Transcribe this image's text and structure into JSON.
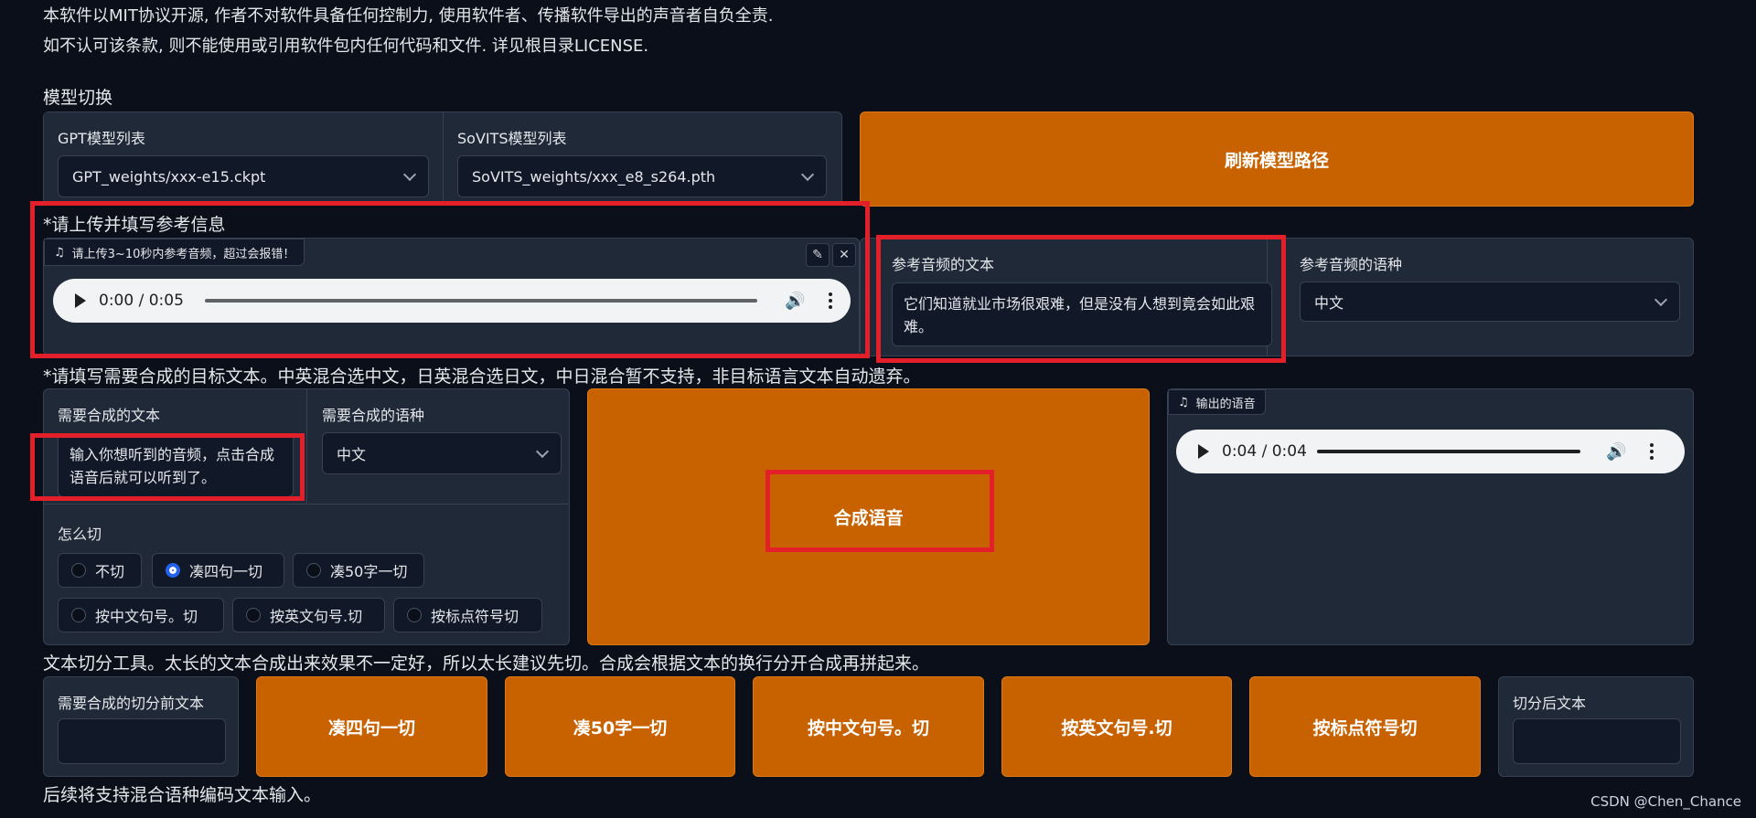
{
  "intro": {
    "line1": "本软件以MIT协议开源, 作者不对软件具备任何控制力, 使用软件者、传播软件导出的声音者自负全责.",
    "line2": "如不认可该条款, 则不能使用或引用软件包内任何代码和文件. 详见根目录LICENSE."
  },
  "model_switch": {
    "section_label": "模型切换",
    "gpt_label": "GPT模型列表",
    "gpt_value": "GPT_weights/xxx-e15.ckpt",
    "sovits_label": "SoVITS模型列表",
    "sovits_value": "SoVITS_weights/xxx_e8_s264.pth",
    "refresh_button": "刷新模型路径"
  },
  "reference": {
    "section_label": "*请上传并填写参考信息",
    "audio_badge": "请上传3~10秒内参考音频，超过会报错！",
    "audio_time": "0:00 / 0:05",
    "audio_progress": 0.0,
    "ref_text_label": "参考音频的文本",
    "ref_text_value": "它们知道就业市场很艰难，但是没有人想到竟会如此艰难。",
    "ref_lang_label": "参考音频的语种",
    "ref_lang_value": "中文"
  },
  "target": {
    "section_label": "*请填写需要合成的目标文本。中英混合选中文，日英混合选日文，中日混合暂不支持，非目标语言文本自动遗弃。",
    "text_label": "需要合成的文本",
    "text_value": "输入你想听到的音频，点击合成语音后就可以听到了。",
    "lang_label": "需要合成的语种",
    "lang_value": "中文",
    "cut_label": "怎么切",
    "cut_options": [
      "不切",
      "凑四句一切",
      "凑50字一切",
      "按中文句号。切",
      "按英文句号.切",
      "按标点符号切"
    ],
    "cut_selected": "凑四句一切",
    "synth_button": "合成语音",
    "output_badge": "输出的语音",
    "output_time": "0:04 / 0:04",
    "output_progress": 1.0
  },
  "splitter": {
    "section_label": "文本切分工具。太长的文本合成出来效果不一定好，所以太长建议先切。合成会根据文本的换行分开合成再拼起来。",
    "input_label": "需要合成的切分前文本",
    "buttons": [
      "凑四句一切",
      "凑50字一切",
      "按中文句号。切",
      "按英文句号.切",
      "按标点符号切"
    ],
    "output_label": "切分后文本"
  },
  "footer": {
    "note": "后续将支持混合语种编码文本输入。",
    "watermark": "CSDN @Chen_Chance"
  },
  "colors": {
    "background": "#0b0f19",
    "panel": "#1f2937",
    "accent_orange": "#c86200",
    "highlight_red": "#e3202a",
    "radio_blue": "#2563eb"
  }
}
